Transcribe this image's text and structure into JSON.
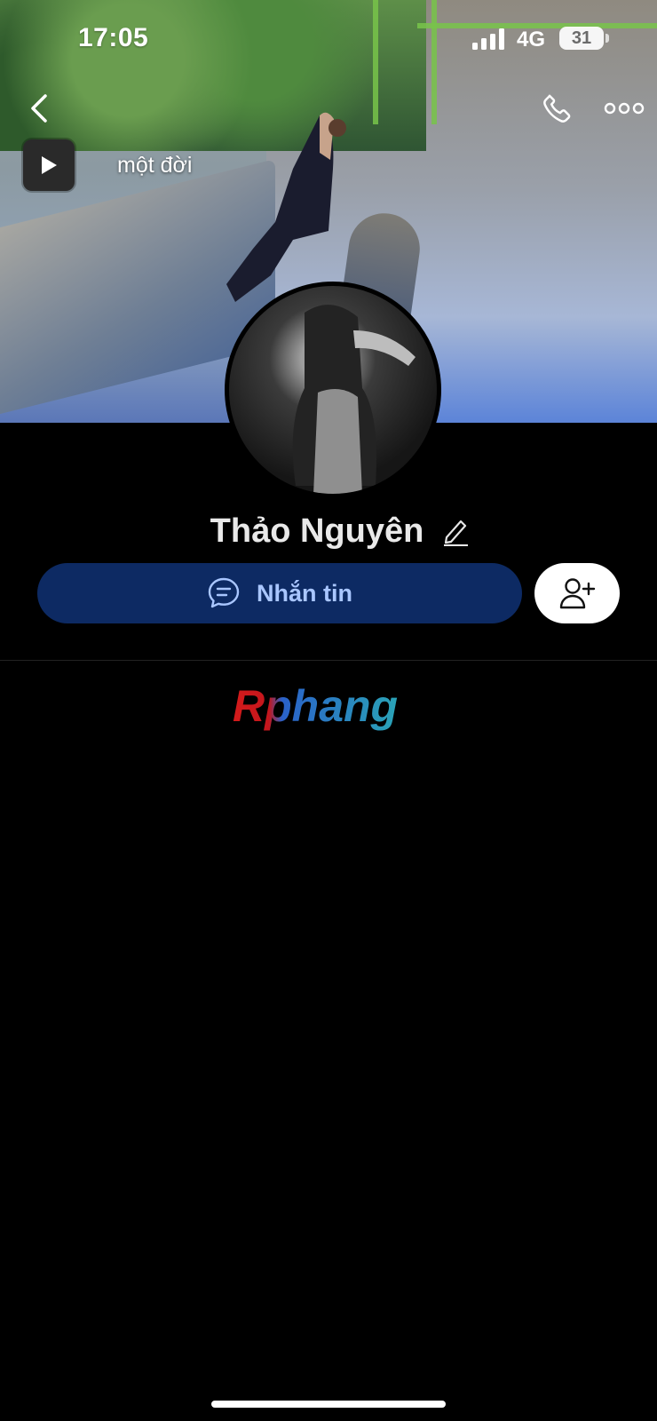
{
  "status_bar": {
    "time": "17:05",
    "network": "4G",
    "battery": "31"
  },
  "profile": {
    "music_title": "một đời",
    "name": "Thảo Nguyên"
  },
  "actions": {
    "message_label": "Nhắn tin"
  },
  "colors": {
    "message_button_bg": "#0d2a63",
    "message_button_text": "#a9c6ff",
    "background": "#000000"
  },
  "watermark": "Rphang"
}
